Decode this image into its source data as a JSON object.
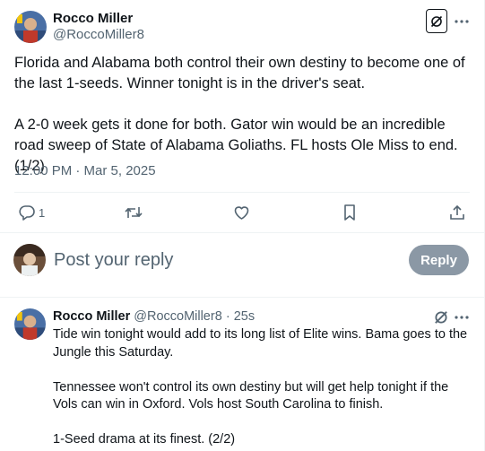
{
  "main_tweet": {
    "author_name": "Rocco Miller",
    "author_handle": "@RoccoMiller8",
    "paragraphs": [
      "Florida and Alabama both control their own destiny to become one of the last 1-seeds. Winner tonight is in the driver's seat.",
      "A 2-0 week gets it done for both. Gator win would be an incredible road sweep of State of Alabama Goliaths. FL hosts Ole Miss to end. (1/2)"
    ],
    "timestamp": "12:00 PM · Mar 5, 2025",
    "actions": {
      "reply_icon": "reply-icon",
      "reply_count": "1",
      "retweet_icon": "retweet-icon",
      "like_icon": "heart-icon",
      "bookmark_icon": "bookmark-icon",
      "share_icon": "share-icon"
    },
    "grok_icon": "grok-icon",
    "more_icon": "more-icon"
  },
  "reply_composer": {
    "placeholder": "Post your reply",
    "button_label": "Reply"
  },
  "reply_tweet": {
    "author_name": "Rocco Miller",
    "author_handle": "@RoccoMiller8",
    "separator": "·",
    "time": "25s",
    "paragraphs": [
      "Tide win tonight would add to its long list of Elite wins. Bama goes to the Jungle this Saturday.",
      "Tennessee won't control its own destiny but will get help tonight if the Vols can win in Oxford. Vols host South Carolina to finish.",
      "1-Seed drama at its finest. (2/2)"
    ]
  },
  "colors": {
    "text": "#0f1419",
    "secondary": "#536471",
    "divider": "#eff3f4",
    "reply_button_disabled": "#8b98a5"
  }
}
